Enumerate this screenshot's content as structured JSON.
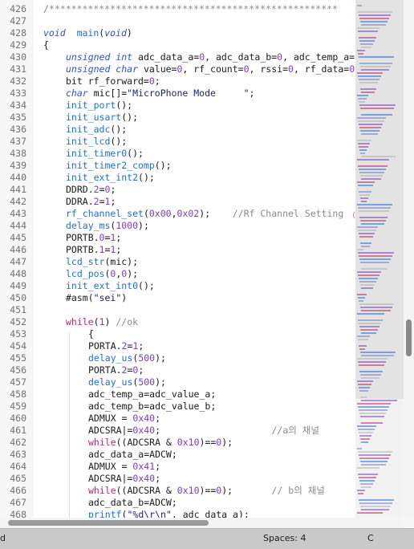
{
  "editor": {
    "lines": [
      {
        "n": "426",
        "indent": 0,
        "tokens": [
          [
            "cmt",
            "/****************************************************"
          ]
        ]
      },
      {
        "n": "427",
        "indent": 0,
        "tokens": []
      },
      {
        "n": "428",
        "indent": 0,
        "tokens": [
          [
            "kw",
            "void"
          ],
          [
            "",
            "  "
          ],
          [
            "fn",
            "main"
          ],
          [
            "",
            "("
          ],
          [
            "kw",
            "void"
          ],
          [
            "",
            ")"
          ]
        ]
      },
      {
        "n": "429",
        "indent": 0,
        "tokens": [
          [
            "",
            "{"
          ]
        ]
      },
      {
        "n": "430",
        "indent": 1,
        "tokens": [
          [
            "kw",
            "unsigned int"
          ],
          [
            "",
            " adc_data_a="
          ],
          [
            "num",
            "0"
          ],
          [
            "",
            ", adc_data_b="
          ],
          [
            "num",
            "0"
          ],
          [
            "",
            ", adc_temp_a="
          ]
        ]
      },
      {
        "n": "431",
        "indent": 1,
        "tokens": [
          [
            "kw",
            "unsigned char"
          ],
          [
            "",
            " value="
          ],
          [
            "num",
            "0"
          ],
          [
            "",
            ", rf_count="
          ],
          [
            "num",
            "0"
          ],
          [
            "",
            ", rssi="
          ],
          [
            "num",
            "0"
          ],
          [
            "",
            ", rf_data="
          ],
          [
            "num",
            "0"
          ]
        ]
      },
      {
        "n": "432",
        "indent": 1,
        "tokens": [
          [
            "",
            "bit rf_forward="
          ],
          [
            "num",
            "0"
          ],
          [
            "",
            ";"
          ]
        ]
      },
      {
        "n": "433",
        "indent": 1,
        "tokens": [
          [
            "kw",
            "char"
          ],
          [
            "",
            " mic[]="
          ],
          [
            "str",
            "\"MicroPhone Mode     \""
          ],
          [
            "",
            ";"
          ]
        ]
      },
      {
        "n": "434",
        "indent": 1,
        "tokens": [
          [
            "fn",
            "init_port"
          ],
          [
            "",
            "();"
          ]
        ]
      },
      {
        "n": "435",
        "indent": 1,
        "tokens": [
          [
            "fn",
            "init_usart"
          ],
          [
            "",
            "();"
          ]
        ]
      },
      {
        "n": "436",
        "indent": 1,
        "tokens": [
          [
            "fn",
            "init_adc"
          ],
          [
            "",
            "();"
          ]
        ]
      },
      {
        "n": "437",
        "indent": 1,
        "tokens": [
          [
            "fn",
            "init_lcd"
          ],
          [
            "",
            "();"
          ]
        ]
      },
      {
        "n": "438",
        "indent": 1,
        "tokens": [
          [
            "fn",
            "init_timer0"
          ],
          [
            "",
            "();"
          ]
        ]
      },
      {
        "n": "439",
        "indent": 1,
        "tokens": [
          [
            "fn",
            "init_timer2_comp"
          ],
          [
            "",
            "();"
          ]
        ]
      },
      {
        "n": "440",
        "indent": 1,
        "tokens": [
          [
            "fn",
            "init_ext_int2"
          ],
          [
            "",
            "();"
          ]
        ]
      },
      {
        "n": "441",
        "indent": 1,
        "tokens": [
          [
            "",
            "DDRD."
          ],
          [
            "num",
            "2"
          ],
          [
            "",
            "="
          ],
          [
            "num",
            "0"
          ],
          [
            "",
            ";"
          ]
        ]
      },
      {
        "n": "442",
        "indent": 1,
        "tokens": [
          [
            "",
            "DDRA."
          ],
          [
            "num",
            "2"
          ],
          [
            "",
            "="
          ],
          [
            "num",
            "1"
          ],
          [
            "",
            ";"
          ]
        ]
      },
      {
        "n": "443",
        "indent": 1,
        "tokens": [
          [
            "fn",
            "rf_channel_set"
          ],
          [
            "",
            "("
          ],
          [
            "num",
            "0x00"
          ],
          [
            "",
            ","
          ],
          [
            "num",
            "0x02"
          ],
          [
            "",
            ");    "
          ],
          [
            "cmt",
            "//Rf Channel Setting"
          ]
        ]
      },
      {
        "n": "444",
        "indent": 1,
        "tokens": [
          [
            "fn",
            "delay_ms"
          ],
          [
            "",
            "("
          ],
          [
            "num",
            "1000"
          ],
          [
            "",
            ");"
          ]
        ]
      },
      {
        "n": "445",
        "indent": 1,
        "tokens": [
          [
            "",
            "PORTB."
          ],
          [
            "num",
            "0"
          ],
          [
            "",
            "="
          ],
          [
            "num",
            "1"
          ],
          [
            "",
            ";"
          ]
        ]
      },
      {
        "n": "446",
        "indent": 1,
        "tokens": [
          [
            "",
            "PORTB."
          ],
          [
            "num",
            "1"
          ],
          [
            "",
            "="
          ],
          [
            "num",
            "1"
          ],
          [
            "",
            ";"
          ]
        ]
      },
      {
        "n": "447",
        "indent": 1,
        "tokens": [
          [
            "fn",
            "lcd_str"
          ],
          [
            "",
            "(mic);"
          ]
        ]
      },
      {
        "n": "448",
        "indent": 1,
        "tokens": [
          [
            "fn",
            "lcd_pos"
          ],
          [
            "",
            "("
          ],
          [
            "num",
            "0"
          ],
          [
            "",
            ","
          ],
          [
            "num",
            "0"
          ],
          [
            "",
            ");"
          ]
        ]
      },
      {
        "n": "449",
        "indent": 1,
        "tokens": [
          [
            "fn",
            "init_ext_int0"
          ],
          [
            "",
            "();"
          ]
        ]
      },
      {
        "n": "450",
        "indent": 1,
        "tokens": [
          [
            "",
            "#asm("
          ],
          [
            "str",
            "\"sei\""
          ],
          [
            "",
            ")"
          ]
        ]
      },
      {
        "n": "451",
        "indent": 0,
        "tokens": []
      },
      {
        "n": "452",
        "indent": 1,
        "tokens": [
          [
            "ctrl",
            "while"
          ],
          [
            "",
            "("
          ],
          [
            "num",
            "1"
          ],
          [
            "",
            ") "
          ],
          [
            "cmt",
            "//ok"
          ]
        ]
      },
      {
        "n": "453",
        "indent": 2,
        "tokens": [
          [
            "",
            "{"
          ]
        ]
      },
      {
        "n": "454",
        "indent": 2,
        "tokens": [
          [
            "",
            "PORTA."
          ],
          [
            "num",
            "2"
          ],
          [
            "",
            "="
          ],
          [
            "num",
            "1"
          ],
          [
            "",
            ";"
          ]
        ]
      },
      {
        "n": "455",
        "indent": 2,
        "tokens": [
          [
            "fn",
            "delay_us"
          ],
          [
            "",
            "("
          ],
          [
            "num",
            "500"
          ],
          [
            "",
            ");"
          ]
        ]
      },
      {
        "n": "456",
        "indent": 2,
        "tokens": [
          [
            "",
            "PORTA."
          ],
          [
            "num",
            "2"
          ],
          [
            "",
            "="
          ],
          [
            "num",
            "0"
          ],
          [
            "",
            ";"
          ]
        ]
      },
      {
        "n": "457",
        "indent": 2,
        "tokens": [
          [
            "fn",
            "delay_us"
          ],
          [
            "",
            "("
          ],
          [
            "num",
            "500"
          ],
          [
            "",
            ");"
          ]
        ]
      },
      {
        "n": "458",
        "indent": 2,
        "tokens": [
          [
            "",
            "adc_temp_a=adc_value_a;"
          ]
        ]
      },
      {
        "n": "459",
        "indent": 2,
        "tokens": [
          [
            "",
            "adc_temp_b=adc_value_b;"
          ]
        ]
      },
      {
        "n": "460",
        "indent": 2,
        "tokens": [
          [
            "",
            "ADMUX = "
          ],
          [
            "num",
            "0x40"
          ],
          [
            "",
            ";"
          ]
        ]
      },
      {
        "n": "461",
        "indent": 2,
        "tokens": [
          [
            "",
            "ADCSRA|="
          ],
          [
            "num",
            "0x40"
          ],
          [
            "",
            ";                    "
          ],
          [
            "cmt",
            "//a의 채널"
          ]
        ]
      },
      {
        "n": "462",
        "indent": 2,
        "tokens": [
          [
            "ctrl",
            "while"
          ],
          [
            "",
            "((ADCSRA & "
          ],
          [
            "num",
            "0x10"
          ],
          [
            "",
            ")=="
          ],
          [
            "num",
            "0"
          ],
          [
            "",
            ");"
          ]
        ]
      },
      {
        "n": "463",
        "indent": 2,
        "tokens": [
          [
            "",
            "adc_data_a=ADCW;"
          ]
        ]
      },
      {
        "n": "464",
        "indent": 2,
        "tokens": [
          [
            "",
            "ADMUX = "
          ],
          [
            "num",
            "0x41"
          ],
          [
            "",
            ";"
          ]
        ]
      },
      {
        "n": "465",
        "indent": 2,
        "tokens": [
          [
            "",
            "ADCSRA|="
          ],
          [
            "num",
            "0x40"
          ],
          [
            "",
            ";"
          ]
        ]
      },
      {
        "n": "466",
        "indent": 2,
        "tokens": [
          [
            "ctrl",
            "while"
          ],
          [
            "",
            "((ADCSRA & "
          ],
          [
            "num",
            "0x10"
          ],
          [
            "",
            ")=="
          ],
          [
            "num",
            "0"
          ],
          [
            "",
            ");       "
          ],
          [
            "cmt",
            "// b의 채널"
          ]
        ]
      },
      {
        "n": "467",
        "indent": 2,
        "tokens": [
          [
            "",
            "adc_data_b=ADCW;"
          ]
        ]
      },
      {
        "n": "468",
        "indent": 2,
        "tokens": [
          [
            "fn",
            "printf"
          ],
          [
            "",
            "("
          ],
          [
            "str",
            "\"%d\\r\\n\""
          ],
          [
            "",
            ", adc_data_a);"
          ]
        ]
      }
    ]
  },
  "status": {
    "left": "d",
    "spaces": "Spaces: 4",
    "syntax": "C"
  },
  "colors": {
    "keyword": "#2f52c9",
    "function": "#1f6fd2",
    "number": "#7a3ec0",
    "control": "#c0246d",
    "comment": "#8a8a8a"
  }
}
